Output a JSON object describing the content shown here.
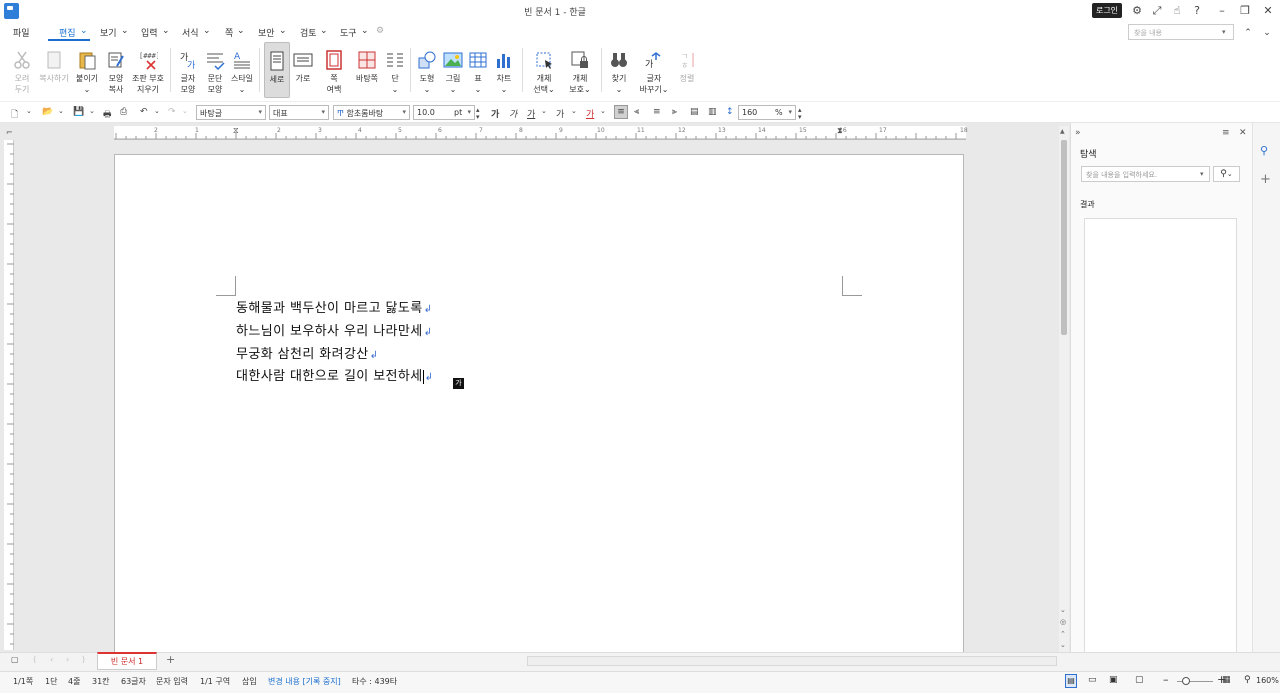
{
  "window": {
    "title": "빈 문서 1 - 한글",
    "login": "로그인"
  },
  "menu": {
    "items": [
      "파일",
      "편집",
      "보기",
      "입력",
      "서식",
      "쪽",
      "보안",
      "검토",
      "도구"
    ],
    "active": "편집",
    "search_placeholder": "찾을 내용"
  },
  "ribbon": [
    {
      "l1": "오려",
      "l2": "두기",
      "disabled": true
    },
    {
      "l1": "복사하기",
      "l2": "",
      "disabled": true
    },
    {
      "l1": "붙이기",
      "l2": ""
    },
    {
      "l1": "모양",
      "l2": "복사"
    },
    {
      "l1": "조판 부호",
      "l2": "지우기"
    },
    {
      "l1": "글자",
      "l2": "모양"
    },
    {
      "l1": "문단",
      "l2": "모양"
    },
    {
      "l1": "스타일",
      "l2": ""
    },
    {
      "l1": "세로",
      "l2": "",
      "selected": true
    },
    {
      "l1": "가로",
      "l2": ""
    },
    {
      "l1": "쪽",
      "l2": "여백"
    },
    {
      "l1": "바탕쪽",
      "l2": ""
    },
    {
      "l1": "단",
      "l2": ""
    },
    {
      "l1": "도형",
      "l2": ""
    },
    {
      "l1": "그림",
      "l2": ""
    },
    {
      "l1": "표",
      "l2": ""
    },
    {
      "l1": "차트",
      "l2": ""
    },
    {
      "l1": "개체",
      "l2": "선택"
    },
    {
      "l1": "개체",
      "l2": "보호"
    },
    {
      "l1": "찾기",
      "l2": ""
    },
    {
      "l1": "글자",
      "l2": "바꾸기"
    },
    {
      "l1": "정렬",
      "l2": "",
      "disabled": true
    }
  ],
  "format": {
    "style": "바탕글",
    "font_lang": "대표",
    "font": "함초롬바탕",
    "font_size": "10.0",
    "size_unit": "pt",
    "line_spacing": "160",
    "spacing_unit": "%",
    "char_buttons": [
      "가",
      "가",
      "가",
      "가",
      "가"
    ]
  },
  "ruler": {
    "h": [
      "2",
      "1",
      "2",
      "3",
      "4",
      "5",
      "6",
      "7",
      "8",
      "9",
      "10",
      "11",
      "12",
      "13",
      "14",
      "15",
      "16",
      "17",
      "18"
    ]
  },
  "document": {
    "lines": [
      "동해물과 백두산이 마르고 닳도록",
      "하느님이 보우하사 우리 나라만세",
      "무궁화 삼천리 화려강산",
      "대한사람 대한으로 길이 보전하세"
    ],
    "para_mark": "↲",
    "ime_indicator": "가"
  },
  "side_panel": {
    "title": "탐색",
    "search_placeholder": "찾을 내용을 입력하세요.",
    "results_label": "결과"
  },
  "tabs": {
    "doc_tab": "빈 문서 1",
    "add": "+"
  },
  "status": {
    "page": "1/1쪽",
    "column": "1단",
    "line": "4줄",
    "col": "31칸",
    "chars": "63글자",
    "input_mode": "문자 입력",
    "section": "1/1 구역",
    "insert": "삽입",
    "track": "변경 내용 [기록 중지]",
    "keystrokes": "타수 : 439타",
    "zoom": "160%"
  }
}
